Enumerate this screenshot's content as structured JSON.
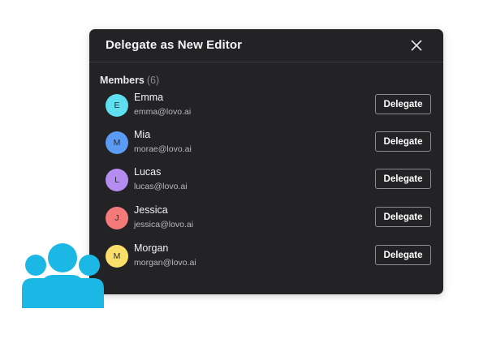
{
  "dialog": {
    "title": "Delegate as New Editor",
    "close_icon": "close-icon"
  },
  "members": {
    "heading": "Members",
    "count": "(6)",
    "action_label": "Delegate",
    "items": [
      {
        "initial": "E",
        "name": "Emma",
        "email": "emma@lovo.ai",
        "avatar_color": "#5ee0f0"
      },
      {
        "initial": "M",
        "name": "Mia",
        "email": "morae@lovo.ai",
        "avatar_color": "#5b9bf3"
      },
      {
        "initial": "L",
        "name": "Lucas",
        "email": "lucas@lovo.ai",
        "avatar_color": "#b58cf0"
      },
      {
        "initial": "J",
        "name": "Jessica",
        "email": "jessica@lovo.ai",
        "avatar_color": "#f47a7a"
      },
      {
        "initial": "M",
        "name": "Morgan",
        "email": "morgan@lovo.ai",
        "avatar_color": "#f9df6a"
      }
    ]
  },
  "decoration": {
    "icon": "team-icon",
    "color": "#1bb8e6"
  }
}
